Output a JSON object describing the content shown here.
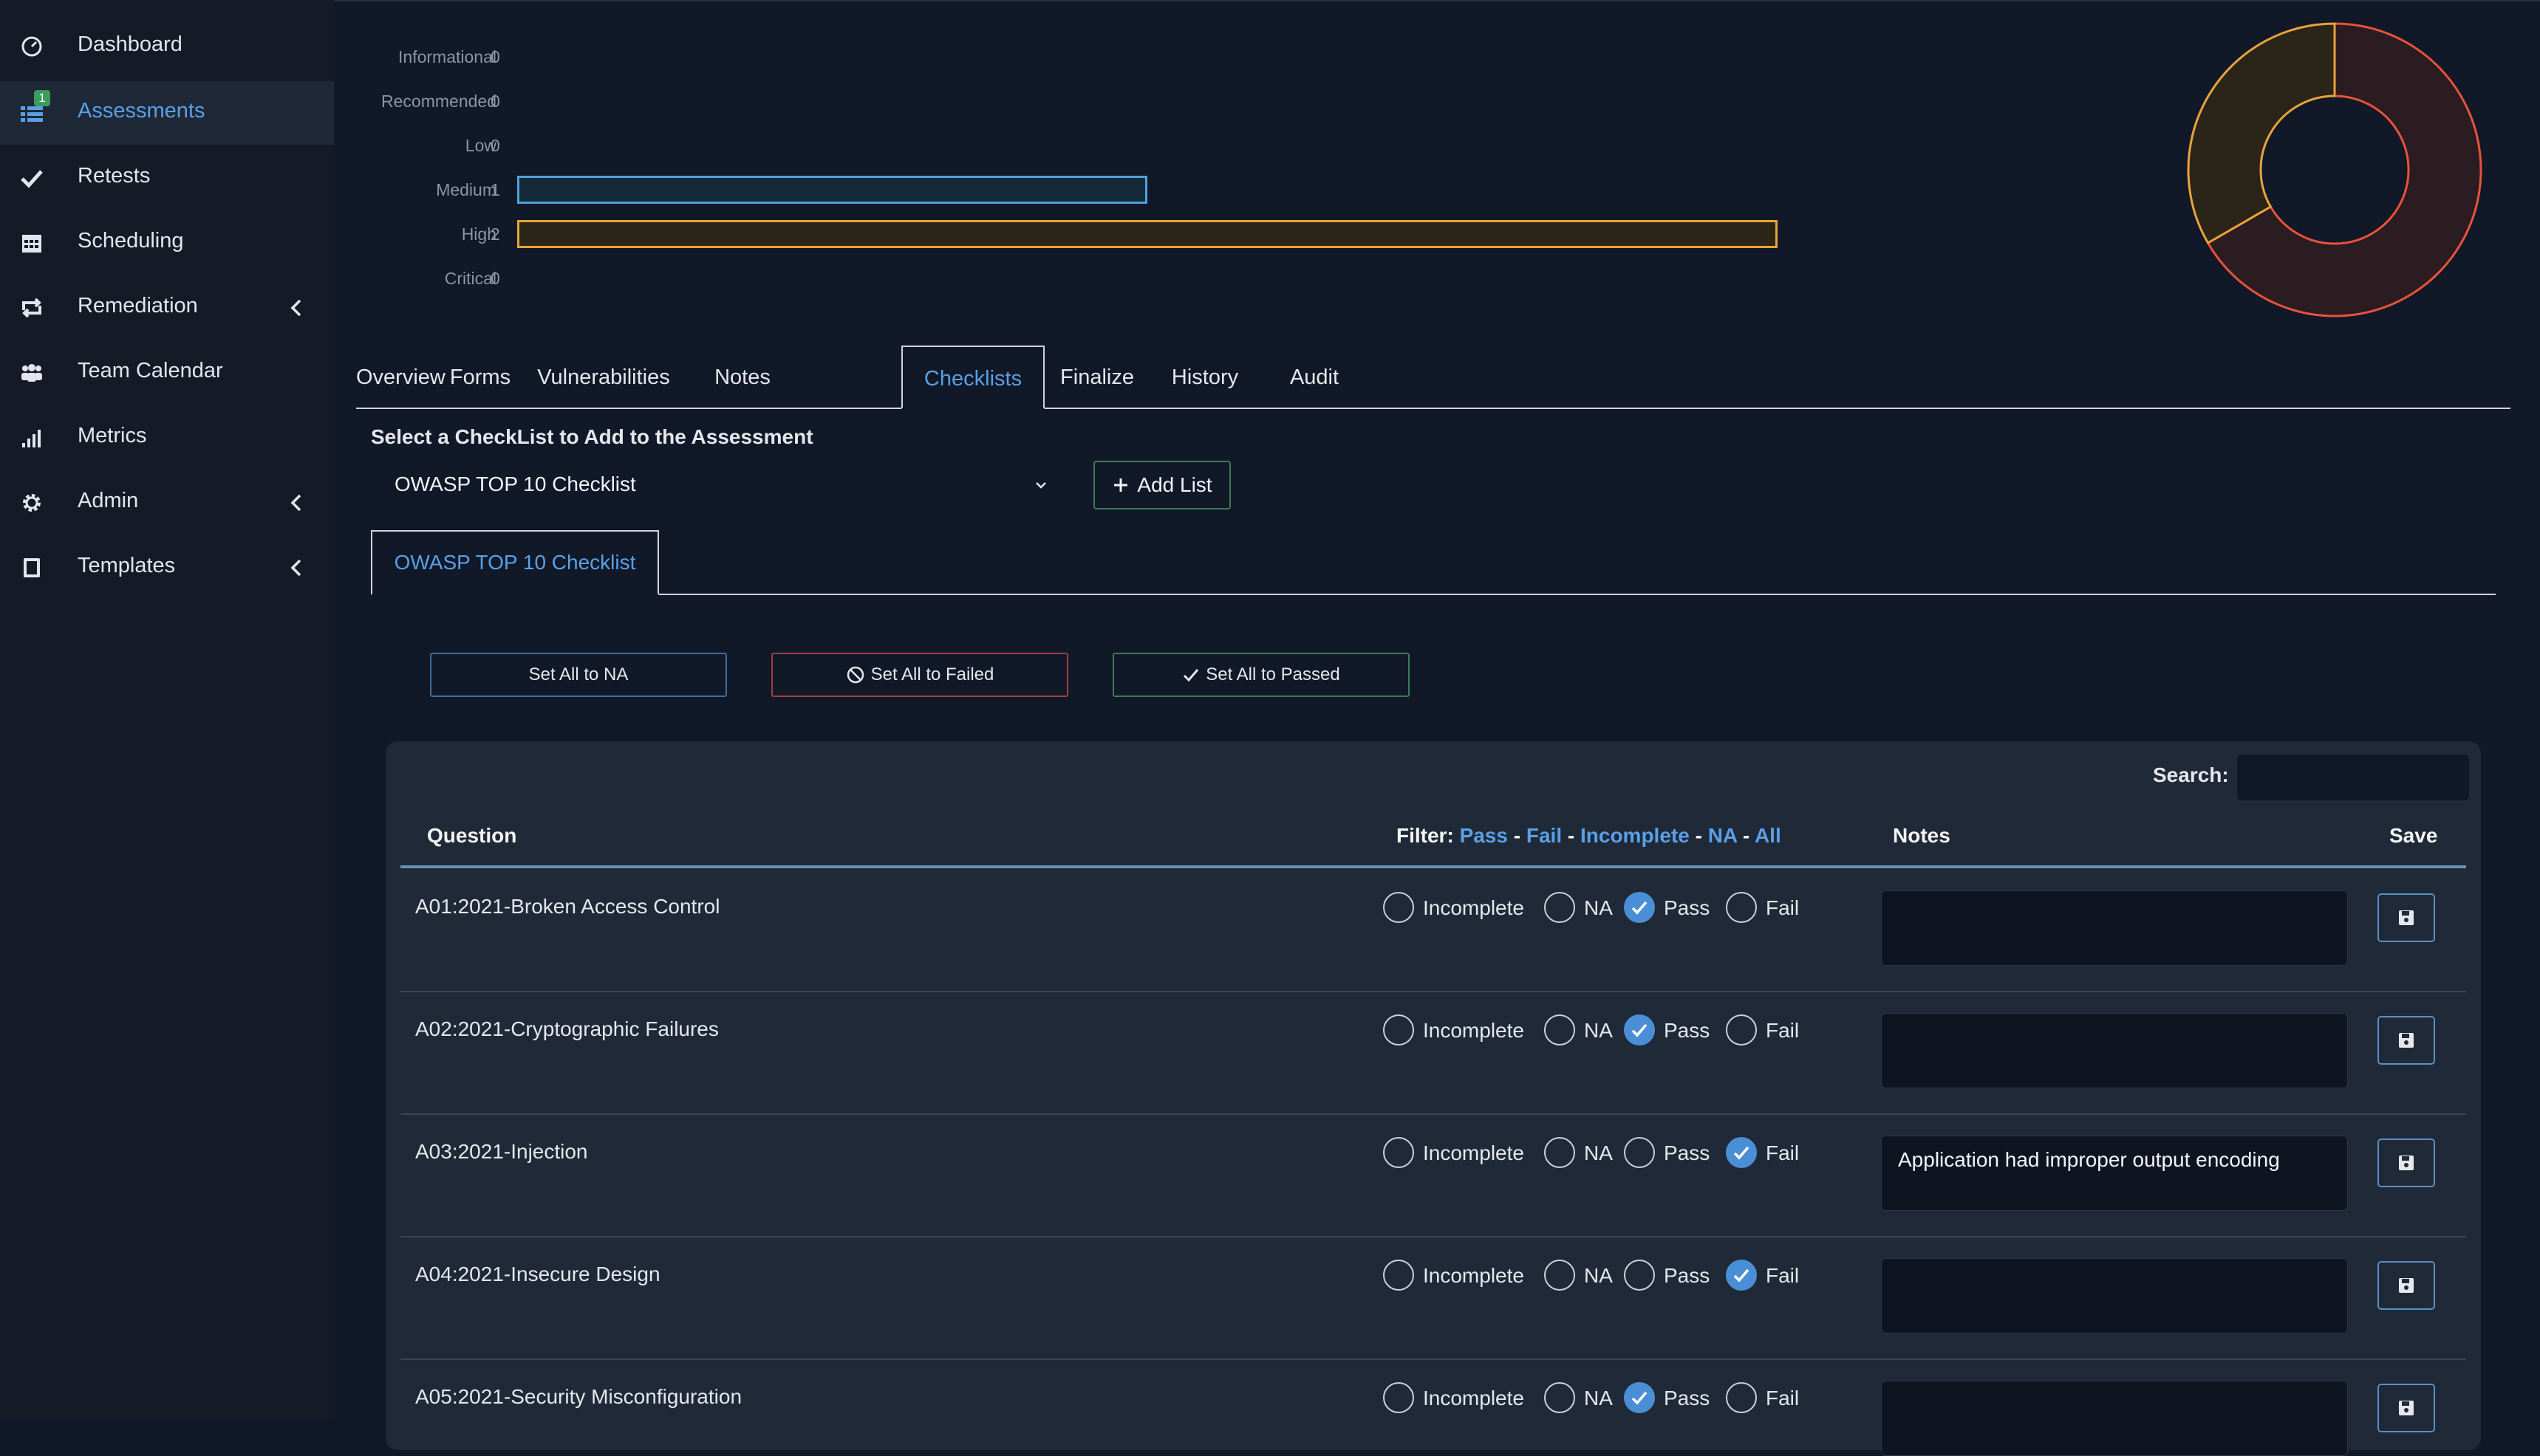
{
  "sidebar": {
    "items": [
      {
        "label": "Dashboard",
        "icon": "dashboard-icon"
      },
      {
        "label": "Assessments",
        "icon": "list-icon",
        "badge": "1",
        "active": true
      },
      {
        "label": "Retests",
        "icon": "check-icon"
      },
      {
        "label": "Scheduling",
        "icon": "calendar-icon"
      },
      {
        "label": "Remediation",
        "icon": "retweet-icon"
      },
      {
        "label": "Team Calendar",
        "icon": "users-icon"
      },
      {
        "label": "Metrics",
        "icon": "signal-icon"
      },
      {
        "label": "Admin",
        "icon": "gear-icon"
      },
      {
        "label": "Templates",
        "icon": "book-icon"
      }
    ]
  },
  "severity_chart": {
    "rows": [
      {
        "label": "Informational",
        "count": "0",
        "value": 0
      },
      {
        "label": "Recommended",
        "count": "0",
        "value": 0
      },
      {
        "label": "Low",
        "count": "0",
        "value": 0
      },
      {
        "label": "Medium",
        "count": "1",
        "value": 1,
        "color": "#4fa3d8"
      },
      {
        "label": "High",
        "count": "2",
        "value": 2,
        "color": "#e8a33a"
      },
      {
        "label": "Critical",
        "count": "0",
        "value": 0
      }
    ],
    "max": 2
  },
  "donut": {
    "slices": [
      {
        "value": 2,
        "color": "#e8533a"
      },
      {
        "value": 1,
        "color": "#e8a33a"
      }
    ]
  },
  "tabs": [
    "Overview",
    "Forms",
    "Vulnerabilities",
    "Notes",
    "Checklists",
    "Finalize",
    "History",
    "Audit"
  ],
  "active_tab": "Checklists",
  "checklist_select": {
    "title": "Select a CheckList to Add to the Assessment",
    "value": "OWASP TOP 10 Checklist",
    "add_label": "Add List"
  },
  "subtab": "OWASP TOP 10 Checklist",
  "actions": {
    "na": "Set All to NA",
    "failed": "Set All to Failed",
    "passed": "Set All to Passed"
  },
  "table": {
    "search_label": "Search:",
    "col_question": "Question",
    "filter_label": "Filter:",
    "filters": [
      "Pass",
      "Fail",
      "Incomplete",
      "NA",
      "All"
    ],
    "col_notes": "Notes",
    "col_save": "Save",
    "options": [
      "Incomplete",
      "NA",
      "Pass",
      "Fail"
    ],
    "rows": [
      {
        "question": "A01:2021-Broken Access Control",
        "status": "Pass",
        "notes": ""
      },
      {
        "question": "A02:2021-Cryptographic Failures",
        "status": "Pass",
        "notes": ""
      },
      {
        "question": "A03:2021-Injection",
        "status": "Fail",
        "notes": "Application had improper output encoding"
      },
      {
        "question": "A04:2021-Insecure Design",
        "status": "Fail",
        "notes": ""
      },
      {
        "question": "A05:2021-Security Misconfiguration",
        "status": "Pass",
        "notes": ""
      }
    ]
  }
}
